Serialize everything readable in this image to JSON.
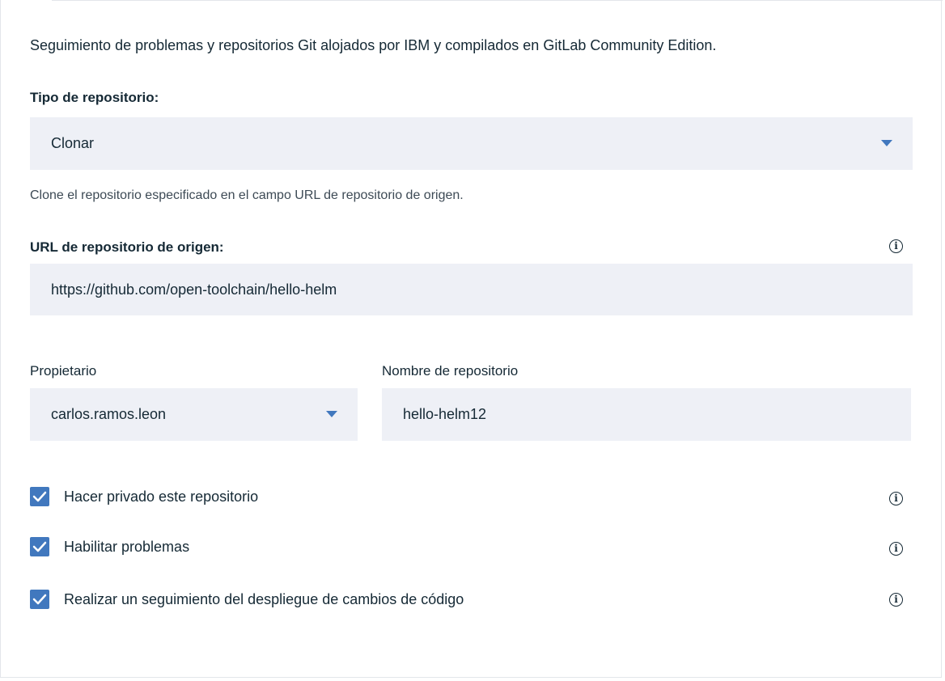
{
  "intro_text": "Seguimiento de problemas y repositorios Git alojados por IBM y compilados en GitLab Community Edition.",
  "repo_type": {
    "label": "Tipo de repositorio:",
    "value": "Clonar",
    "helper": "Clone el repositorio especificado en el campo URL de repositorio de origen."
  },
  "source_url": {
    "label": "URL de repositorio de origen:",
    "value": "https://github.com/open-toolchain/hello-helm",
    "info_icon": "info-icon"
  },
  "owner": {
    "label": "Propietario",
    "value": "carlos.ramos.leon"
  },
  "repo_name": {
    "label": "Nombre de repositorio",
    "value": "hello-helm12"
  },
  "options": [
    {
      "label": "Hacer privado este repositorio",
      "checked": true,
      "info_icon": "info-icon"
    },
    {
      "label": "Habilitar problemas",
      "checked": true,
      "info_icon": "info-icon"
    },
    {
      "label": "Realizar un seguimiento del despliegue de cambios de código",
      "checked": true,
      "info_icon": "info-icon"
    }
  ],
  "colors": {
    "accent": "#4178be",
    "field_bg": "#eef0f6",
    "text": "#152935"
  }
}
